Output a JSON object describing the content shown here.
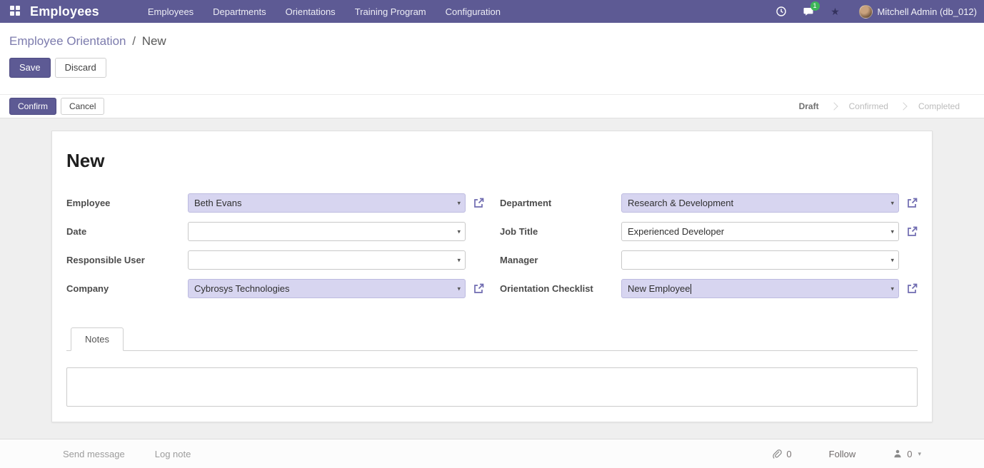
{
  "topbar": {
    "app_name": "Employees",
    "menus": [
      "Employees",
      "Departments",
      "Orientations",
      "Training Program",
      "Configuration"
    ],
    "unread_count": "1",
    "user_name": "Mitchell Admin (db_012)"
  },
  "breadcrumb": {
    "parent": "Employee Orientation",
    "separator": "/",
    "current": "New"
  },
  "actions": {
    "save": "Save",
    "discard": "Discard",
    "confirm": "Confirm",
    "cancel": "Cancel"
  },
  "statusbar": {
    "states": [
      {
        "label": "Draft",
        "active": true
      },
      {
        "label": "Confirmed",
        "active": false
      },
      {
        "label": "Completed",
        "active": false
      }
    ]
  },
  "sheet": {
    "title": "New",
    "fields": {
      "left": [
        {
          "label": "Employee",
          "value": "Beth Evans",
          "highlight": true,
          "external": true
        },
        {
          "label": "Date",
          "value": "",
          "highlight": false,
          "external": false
        },
        {
          "label": "Responsible User",
          "value": "",
          "highlight": false,
          "external": false
        },
        {
          "label": "Company",
          "value": "Cybrosys Technologies",
          "highlight": true,
          "external": true
        }
      ],
      "right": [
        {
          "label": "Department",
          "value": "Research & Development",
          "highlight": true,
          "external": true
        },
        {
          "label": "Job Title",
          "value": "Experienced Developer",
          "highlight": false,
          "external": true
        },
        {
          "label": "Manager",
          "value": "",
          "highlight": false,
          "external": false
        },
        {
          "label": "Orientation Checklist",
          "value": "New Employee",
          "highlight": true,
          "external": true
        }
      ]
    },
    "tabs": [
      {
        "label": "Notes",
        "active": true
      }
    ]
  },
  "chatter": {
    "send_message": "Send message",
    "log_note": "Log note",
    "attachment_count": "0",
    "follow_label": "Follow",
    "follower_count": "0"
  },
  "icons": {
    "caret": "▾",
    "star": "★",
    "followers_caret": "▾"
  },
  "colors": {
    "navbar": "#5d5a94",
    "primary_button": "#5d5a94",
    "link": "#7c7bad",
    "field_highlight_bg": "#d7d5f0",
    "badge_green": "#3db558",
    "content_bg": "#efefef"
  }
}
